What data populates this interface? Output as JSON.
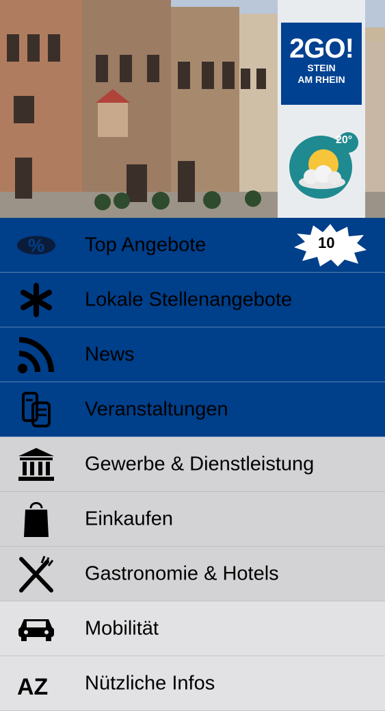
{
  "header": {
    "logo_line1": "2GO!",
    "logo_line2": "STEIN",
    "logo_line3": "AM RHEIN",
    "temperature": "20°"
  },
  "badge": {
    "count": "10"
  },
  "menu": {
    "items": [
      {
        "label": "Top Angebote",
        "icon": "percent-icon"
      },
      {
        "label": "Lokale Stellenangebote",
        "icon": "asterisk-icon"
      },
      {
        "label": "News",
        "icon": "rss-icon"
      },
      {
        "label": "Veranstaltungen",
        "icon": "events-icon"
      },
      {
        "label": "Gewerbe & Dienstleistung",
        "icon": "bank-icon"
      },
      {
        "label": "Einkaufen",
        "icon": "shopping-bag-icon"
      },
      {
        "label": "Gastronomie & Hotels",
        "icon": "fork-knife-icon"
      },
      {
        "label": "Mobilität",
        "icon": "car-icon"
      },
      {
        "label": "Nützliche Infos",
        "icon": "az-icon"
      }
    ]
  },
  "colors": {
    "primary": "#003f8a",
    "gray": "#d3d3d5",
    "light": "#e2e2e4"
  }
}
